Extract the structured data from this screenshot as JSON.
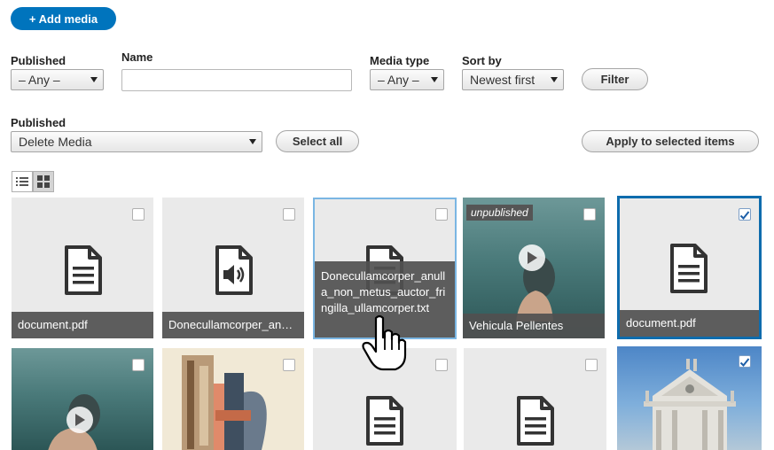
{
  "toolbar": {
    "add_media_label": "+ Add media"
  },
  "filters": {
    "published_label": "Published",
    "published_value": "– Any –",
    "name_label": "Name",
    "name_value": "",
    "media_type_label": "Media type",
    "media_type_value": "– Any –",
    "sort_by_label": "Sort by",
    "sort_by_value": "Newest first",
    "filter_button": "Filter"
  },
  "bulk": {
    "action_label": "Published",
    "action_value": "Delete Media",
    "select_all_button": "Select all",
    "apply_button": "Apply to selected items"
  },
  "view_toggle": {
    "list_icon": "list-icon",
    "grid_icon": "grid-icon"
  },
  "media_items": [
    {
      "name": "document.pdf",
      "icon": "document-icon",
      "checked": false
    },
    {
      "name": "Donecullamcorper_an…",
      "icon": "audio-file-icon",
      "checked": false
    },
    {
      "name": "Donecullamcorper_anulla_non_metus_auctor_fringilla_ullamcorper.txt",
      "icon": "document-icon",
      "checked": false,
      "state": "hover"
    },
    {
      "name": "Vehicula Pellentes",
      "icon": "video-thumbnail",
      "badge": "unpublished",
      "checked": false
    },
    {
      "name": "document.pdf",
      "icon": "document-icon",
      "checked": true,
      "state": "selected"
    },
    {
      "name": "",
      "icon": "video-thumbnail",
      "checked": false
    },
    {
      "name": "",
      "icon": "image-thumbnail",
      "checked": false
    },
    {
      "name": "",
      "icon": "document-icon",
      "checked": false
    },
    {
      "name": "",
      "icon": "document-icon",
      "checked": false
    },
    {
      "name": "",
      "icon": "image-thumbnail",
      "checked": true,
      "state": "selected"
    }
  ],
  "colors": {
    "primary": "#0074bd",
    "selected_outline": "#0e6cad",
    "hover_outline": "#7ab6e3",
    "caption_bg": "#505050"
  }
}
